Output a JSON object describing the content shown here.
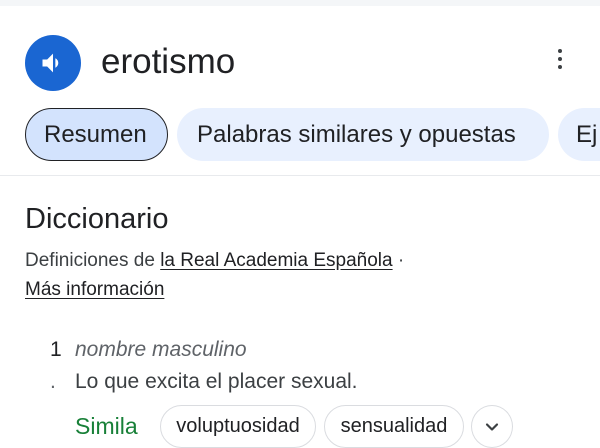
{
  "entry": {
    "word": "erotismo",
    "speaker_icon": "speaker-icon",
    "more_icon": "more-vert-icon"
  },
  "tabs": [
    {
      "label": "Resumen",
      "active": true
    },
    {
      "label": "Palabras similares y opuestas",
      "active": false
    },
    {
      "label": "Ej",
      "active": false
    }
  ],
  "dictionary": {
    "title": "Diccionario",
    "source_prefix": "Definiciones de ",
    "source_link": "la Real Academia Española",
    "separator": " ·",
    "more_info": "Más información"
  },
  "senses": [
    {
      "number": "1",
      "dot": ".",
      "part_of_speech": "nombre masculino",
      "definition": "Lo que excita el placer sexual.",
      "synonyms_label": "Simila",
      "synonyms": [
        "voluptuosidad",
        "sensualidad"
      ],
      "expand_icon": "chevron-down-icon"
    }
  ],
  "colors": {
    "accent": "#1a66d2",
    "chip_bg": "#e8f0fe",
    "chip_active_bg": "#d3e3fd",
    "synonym_label": "#188038"
  }
}
